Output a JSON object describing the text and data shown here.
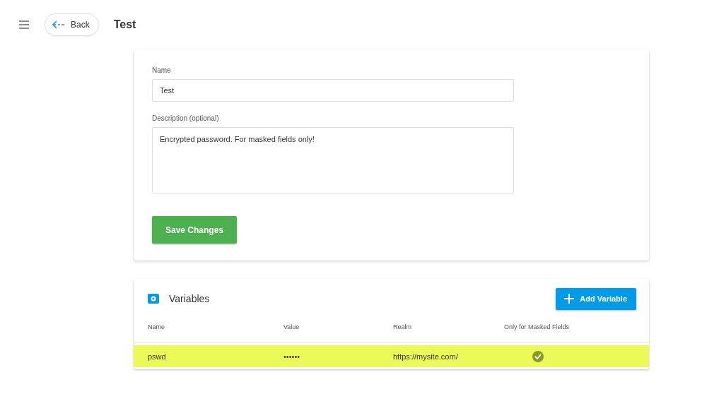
{
  "header": {
    "back_label": "Back",
    "title": "Test"
  },
  "form": {
    "name_label": "Name",
    "name_value": "Test",
    "description_label": "Description (optional)",
    "description_value": "Encrypted password. For masked fields only!",
    "save_label": "Save Changes"
  },
  "variables": {
    "title": "Variables",
    "add_label": "Add Variable",
    "columns": [
      "Name",
      "Value",
      "Realm",
      "Only for Masked Fields"
    ],
    "rows": [
      {
        "name": "pswd",
        "value": "••••••",
        "realm": "https://mysite.com/",
        "masked_only": true,
        "selected": true
      }
    ]
  }
}
